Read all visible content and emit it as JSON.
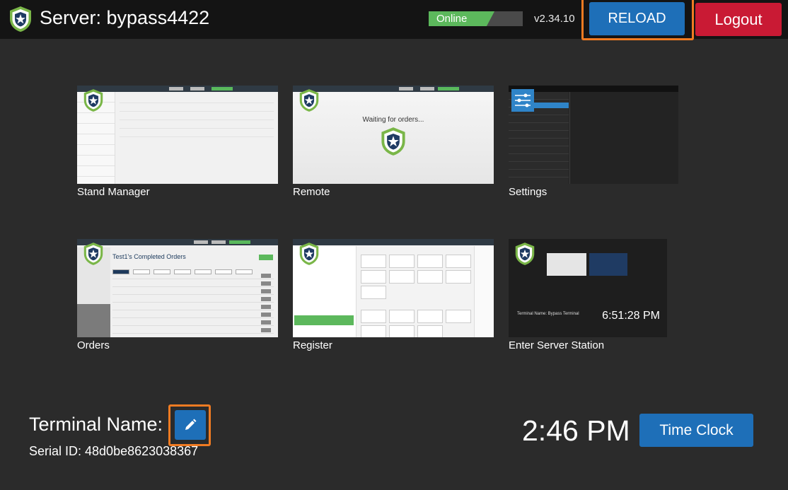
{
  "header": {
    "server_title": "Server: bypass4422",
    "status_label": "Online",
    "status_progress": 0.7,
    "version": "v2.34.10",
    "reload_label": "RELOAD",
    "logout_label": "Logout"
  },
  "tiles": [
    {
      "label": "Stand Manager"
    },
    {
      "label": "Remote",
      "thumb_text": "Waiting for orders..."
    },
    {
      "label": "Settings"
    },
    {
      "label": "Orders",
      "thumb_title": "Test1's Completed Orders"
    },
    {
      "label": "Register"
    },
    {
      "label": "Enter Server Station",
      "thumb_time": "6:51:28 PM",
      "thumb_terminal": "Terminal Name: Bypass Terminal"
    }
  ],
  "footer": {
    "terminal_name_label": "Terminal Name:",
    "serial_id": "Serial ID: 48d0be8623038367",
    "clock": "2:46 PM",
    "time_clock_label": "Time Clock"
  },
  "colors": {
    "accent_blue": "#1e6fb8",
    "logout_red": "#c91a34",
    "online_green": "#5cb85c",
    "highlight_orange": "#f07b22",
    "background": "#2b2b2b",
    "header_bg": "#141414"
  },
  "icons": {
    "logo": "shield-star-icon",
    "edit": "pencil-icon"
  }
}
